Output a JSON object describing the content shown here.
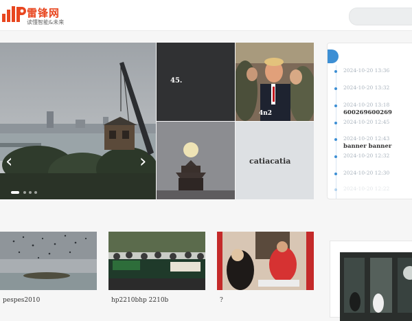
{
  "header": {
    "logo_text": "雷锋网",
    "logo_tagline": "读懂智能&未来",
    "search_placeholder": "",
    "brand_color": "#e8461f"
  },
  "slider": {
    "prev_icon": "chevron-left-icon",
    "next_icon": "chevron-right-icon",
    "prev_glyph": "‹",
    "next_glyph": "›",
    "dot_count": 4,
    "active_dot": 0
  },
  "grid": {
    "tiles": [
      {
        "label": "45."
      },
      {
        "label": "4n2"
      },
      {
        "label": ""
      },
      {
        "label": "catiacatia"
      }
    ]
  },
  "timeline": {
    "accent_color": "#3d8fd4",
    "items": [
      {
        "time": "2024-10-20 13:36",
        "title": ""
      },
      {
        "time": "2024-10-20 13:32",
        "title": ""
      },
      {
        "time": "2024-10-20 13:18",
        "title": "600269600269"
      },
      {
        "time": "2024-10-20 12:45",
        "title": ""
      },
      {
        "time": "2024-10-20 12:43",
        "title": "banner banner"
      },
      {
        "time": "2024-10-20 12:32",
        "title": ""
      },
      {
        "time": "2024-10-20 12:30",
        "title": ""
      },
      {
        "time": "2024-10-20 12:22",
        "title": ""
      }
    ]
  },
  "cards": [
    {
      "caption": "pespes2010"
    },
    {
      "caption": "hp2210bhp 2210b"
    },
    {
      "caption": "?"
    }
  ]
}
